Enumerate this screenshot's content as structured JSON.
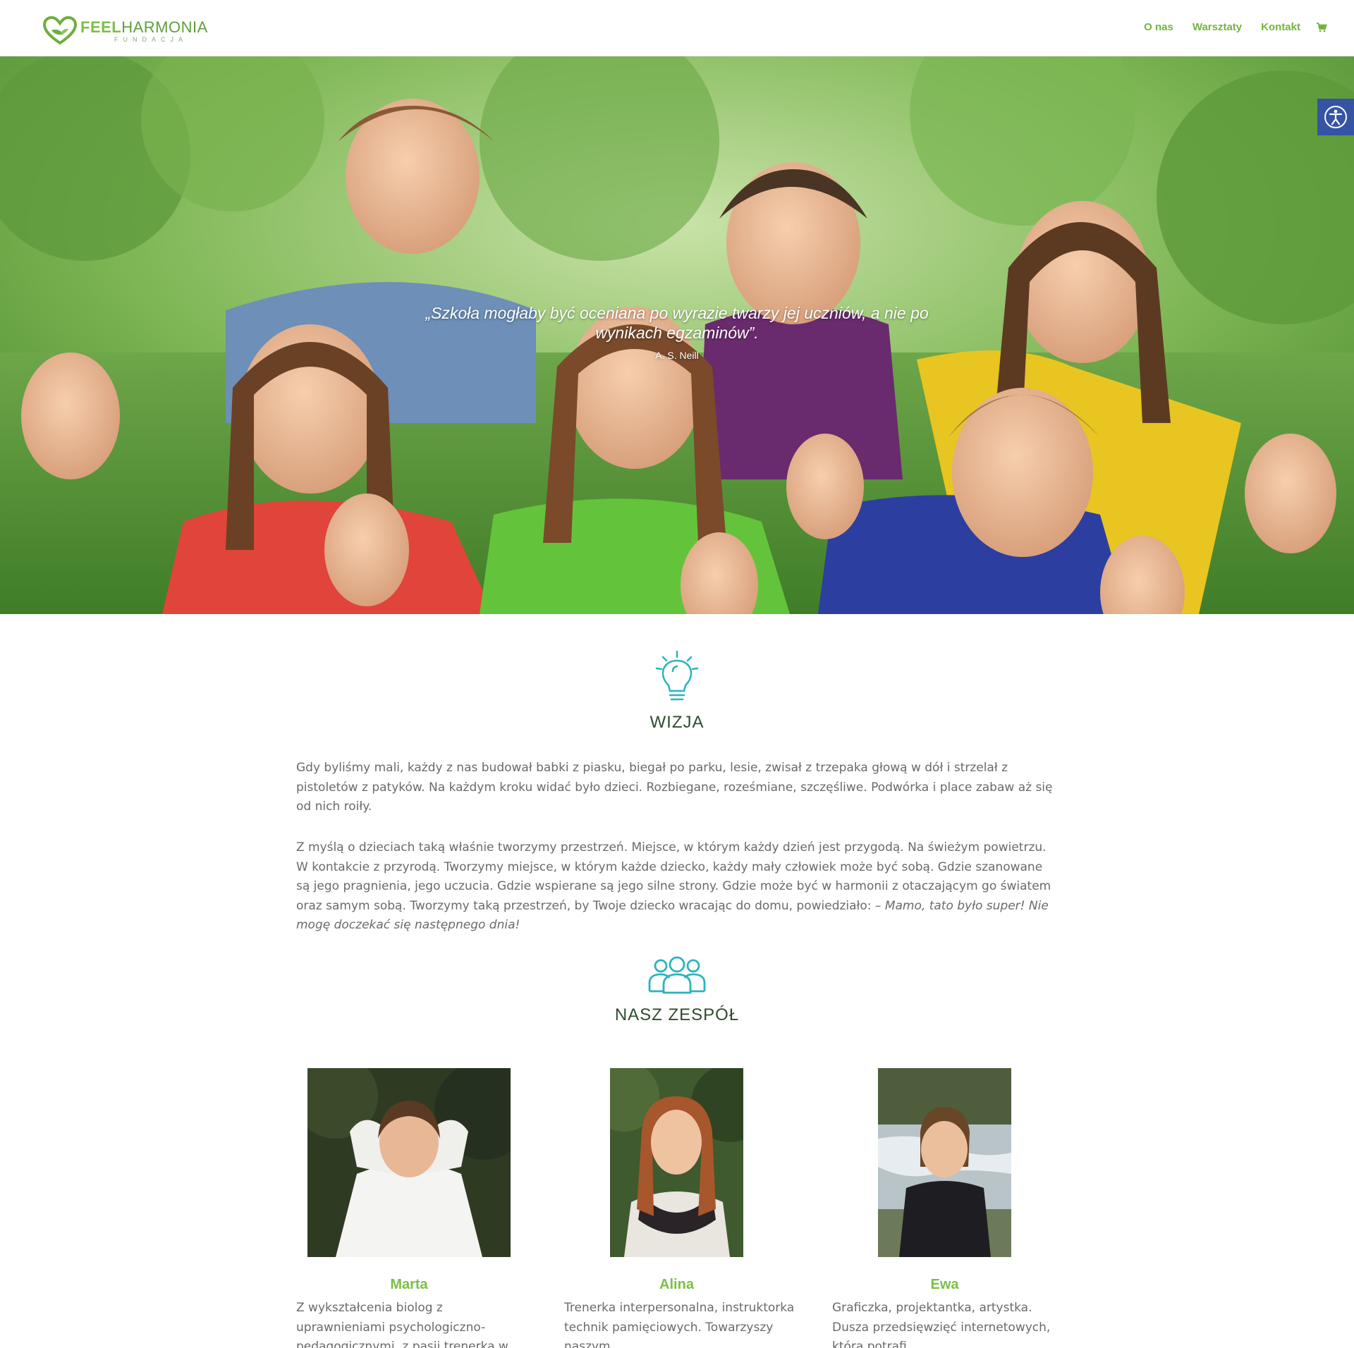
{
  "brand": {
    "name_bold": "FEEL",
    "name_regular": "HARMONIA",
    "subtitle": "FUNDACJA",
    "accent_color": "#7bbf45"
  },
  "nav": {
    "items": [
      {
        "label": "O nas"
      },
      {
        "label": "Warsztaty"
      },
      {
        "label": "Kontakt"
      }
    ],
    "cart_icon": "cart-icon"
  },
  "hero": {
    "quote": "„Szkoła mogłaby być oceniana po wyrazie twarzy jej uczniów, a nie po wynikach egzaminów”.",
    "author": "A. S. Neill"
  },
  "accessibility": {
    "icon": "accessibility-icon",
    "color": "#3554a4"
  },
  "vision": {
    "icon": "lightbulb-icon",
    "title": "WIZJA",
    "paragraph1": "Gdy byliśmy mali, każdy z nas budował babki z piasku, biegał po parku, lesie, zwisał z trzepaka głową w dół i strzelał z pistoletów z patyków. Na każdym kroku widać było dzieci. Rozbiegane, roześmiane, szczęśliwe. Podwórka i place zabaw aż się od nich roiły.",
    "paragraph2": "Z myślą o dzieciach taką właśnie tworzymy przestrzeń. Miejsce, w którym każdy dzień jest przygodą. Na świeżym powietrzu. W kontakcie z przyrodą. Tworzymy miejsce, w którym każde dziecko, każdy mały człowiek może być sobą. Gdzie szanowane są jego pragnienia, jego uczucia. Gdzie wspierane są jego silne strony. Gdzie może być w harmonii z otaczającym go światem oraz samym sobą. Tworzymy taką przestrzeń, by Twoje dziecko wracając do domu, powiedziało: –",
    "paragraph2_italic": "Mamo, tato było super! Nie mogę doczekać się następnego dnia!"
  },
  "team": {
    "icon": "group-icon",
    "title": "NASZ ZESPÓŁ",
    "members": [
      {
        "name": "Marta",
        "bio": "Z wykształcenia biolog z uprawnieniami psychologiczno-pedagogicznymi, z pasji trenerka w"
      },
      {
        "name": "Alina",
        "bio": "Trenerka interpersonalna, instruktorka technik pamięciowych. Towarzyszy naszym"
      },
      {
        "name": "Ewa",
        "bio": "Graficzka, projektantka, artystka. Dusza przedsięwzięć internetowych, która potrafi"
      }
    ]
  }
}
